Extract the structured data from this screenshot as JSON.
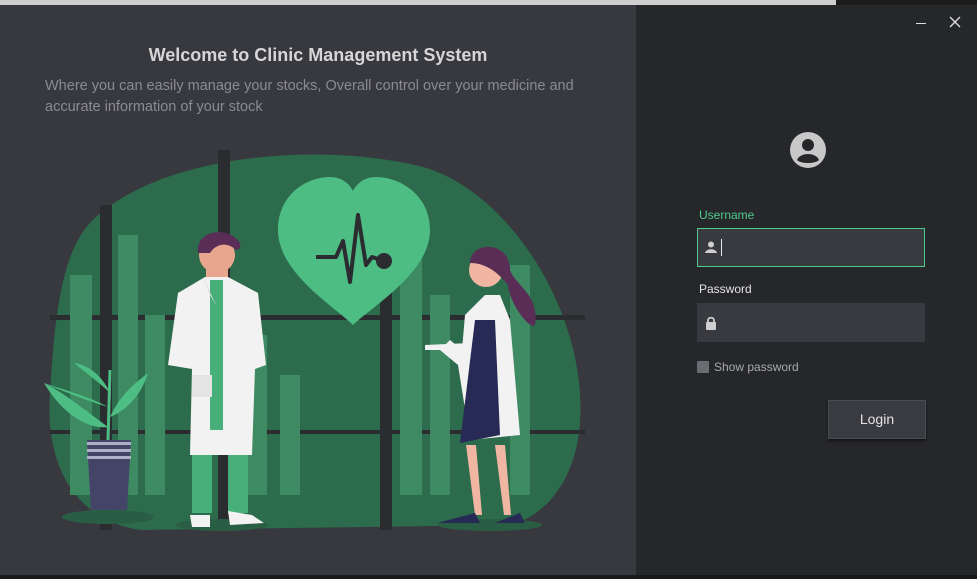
{
  "window": {
    "minimize_icon": "minimize-icon",
    "close_icon": "close-icon"
  },
  "welcome": {
    "title": "Welcome to Clinic Management System",
    "subtitle": "Where you can easily manage your stocks, Overall control over your medicine and accurate information of your stock"
  },
  "illustration": {
    "icons": [
      "heart-icon",
      "doctor-icon",
      "plant-icon"
    ]
  },
  "login": {
    "avatar_icon": "user-circle-icon",
    "username_label": "Username",
    "username_value": "",
    "password_label": "Password",
    "password_value": "",
    "show_password_label": "Show password",
    "show_password_checked": false,
    "login_label": "Login"
  },
  "colors": {
    "accent": "#4fc98a",
    "left_panel": "#38393e",
    "right_panel": "#26272b",
    "field_bg": "#393a3f"
  }
}
